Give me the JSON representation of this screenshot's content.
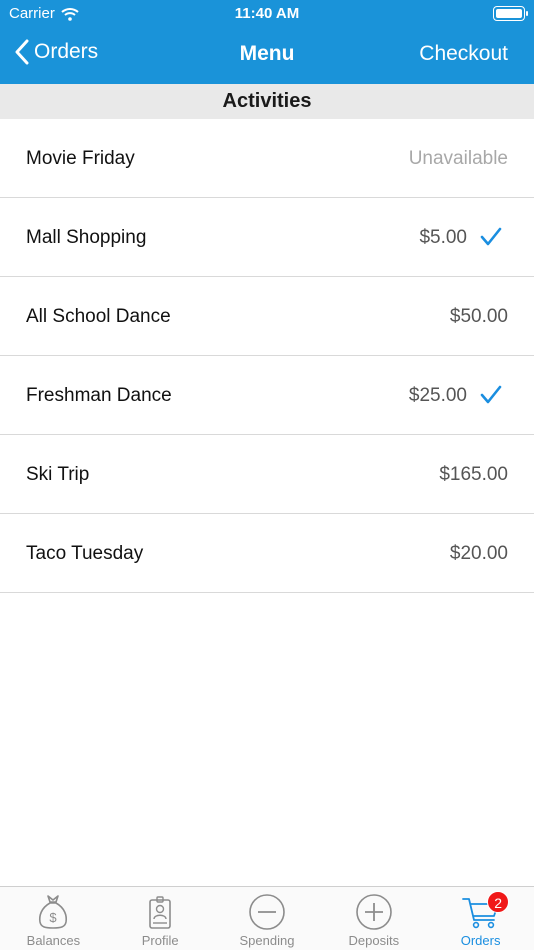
{
  "status_bar": {
    "carrier": "Carrier",
    "time": "11:40 AM"
  },
  "nav": {
    "back_label": "Orders",
    "title": "Menu",
    "action_label": "Checkout"
  },
  "section": {
    "title": "Activities"
  },
  "items": [
    {
      "name": "Movie Friday",
      "price": "Unavailable",
      "selected": false
    },
    {
      "name": "Mall Shopping",
      "price": "$5.00",
      "selected": true
    },
    {
      "name": "All School Dance",
      "price": "$50.00",
      "selected": false
    },
    {
      "name": "Freshman Dance",
      "price": "$25.00",
      "selected": true
    },
    {
      "name": "Ski Trip",
      "price": "$165.00",
      "selected": false
    },
    {
      "name": "Taco Tuesday",
      "price": "$20.00",
      "selected": false
    }
  ],
  "tabs": [
    {
      "label": "Balances",
      "icon": "money-bag-icon"
    },
    {
      "label": "Profile",
      "icon": "id-badge-icon"
    },
    {
      "label": "Spending",
      "icon": "minus-circle-icon"
    },
    {
      "label": "Deposits",
      "icon": "plus-circle-icon"
    },
    {
      "label": "Orders",
      "icon": "cart-icon",
      "badge": "2",
      "active": true
    }
  ],
  "colors": {
    "header": "#1a93d9",
    "accent": "#1a8ee0",
    "badge": "#f01818"
  }
}
